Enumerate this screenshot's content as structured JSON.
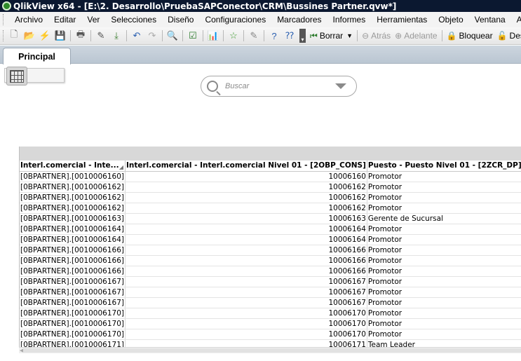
{
  "window": {
    "title": "QlikView x64 - [E:\\2. Desarrollo\\PruebaSAPConector\\CRM\\Bussines Partner.qvw*]"
  },
  "menu": [
    "Archivo",
    "Editar",
    "Ver",
    "Selecciones",
    "Diseño",
    "Configuraciones",
    "Marcadores",
    "Informes",
    "Herramientas",
    "Objeto",
    "Ventana",
    "Ayuda"
  ],
  "toolbar": {
    "borrar_label": "Borrar",
    "atras_label": "Atrás",
    "adelante_label": "Adelante",
    "bloquear_label": "Bloquear",
    "desbloquear_label": "Desb"
  },
  "tabs": [
    {
      "label": "Principal"
    }
  ],
  "search": {
    "placeholder": "Buscar"
  },
  "table": {
    "headers": [
      "Interl.comercial - Inte...",
      "Interl.comercial - Interl.comercial Nivel 01 - [2OBP_CONS]",
      "Puesto - Puesto Nivel 01 - [2ZCR_DP]"
    ],
    "rows": [
      [
        "[0BPARTNER].[0010006160]",
        "10006160",
        "Promotor"
      ],
      [
        "[0BPARTNER].[0010006162]",
        "10006162",
        "Promotor"
      ],
      [
        "[0BPARTNER].[0010006162]",
        "10006162",
        "Promotor"
      ],
      [
        "[0BPARTNER].[0010006162]",
        "10006162",
        "Promotor"
      ],
      [
        "[0BPARTNER].[0010006163]",
        "10006163",
        "Gerente de Sucursal"
      ],
      [
        "[0BPARTNER].[0010006164]",
        "10006164",
        "Promotor"
      ],
      [
        "[0BPARTNER].[0010006164]",
        "10006164",
        "Promotor"
      ],
      [
        "[0BPARTNER].[0010006166]",
        "10006166",
        "Promotor"
      ],
      [
        "[0BPARTNER].[0010006166]",
        "10006166",
        "Promotor"
      ],
      [
        "[0BPARTNER].[0010006166]",
        "10006166",
        "Promotor"
      ],
      [
        "[0BPARTNER].[0010006167]",
        "10006167",
        "Promotor"
      ],
      [
        "[0BPARTNER].[0010006167]",
        "10006167",
        "Promotor"
      ],
      [
        "[0BPARTNER].[0010006167]",
        "10006167",
        "Promotor"
      ],
      [
        "[0BPARTNER].[0010006170]",
        "10006170",
        "Promotor"
      ],
      [
        "[0BPARTNER].[0010006170]",
        "10006170",
        "Promotor"
      ],
      [
        "[0BPARTNER].[0010006170]",
        "10006170",
        "Promotor"
      ],
      [
        "[0BPARTNER].[0010006171]",
        "10006171",
        "Team Leader"
      ]
    ]
  }
}
